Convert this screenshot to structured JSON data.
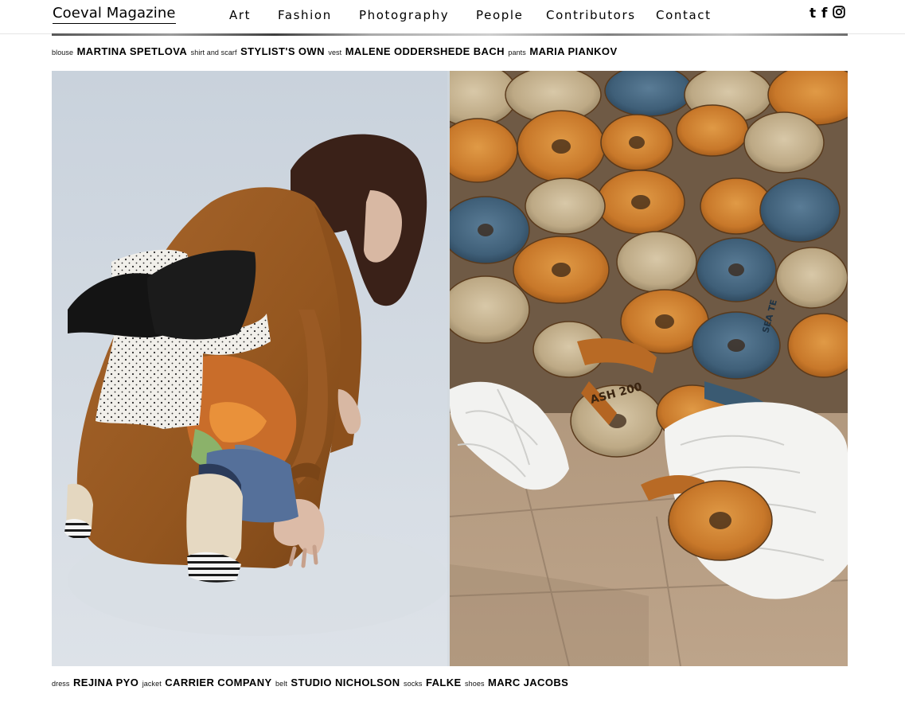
{
  "header": {
    "brand": "Coeval Magazine",
    "nav": [
      {
        "label": "Art"
      },
      {
        "label": "Fashion"
      },
      {
        "label": "Photography"
      },
      {
        "label": "People"
      },
      {
        "label": "Contributors"
      },
      {
        "label": "Contact"
      }
    ],
    "social": {
      "tumblr_glyph": "t",
      "facebook_glyph": "f",
      "icons": [
        "tumblr-icon",
        "facebook-icon",
        "instagram-icon"
      ]
    }
  },
  "credits_top": [
    {
      "item": "blouse",
      "name": "MARTINA SPETLOVA"
    },
    {
      "item": "shirt and scarf",
      "name": "STYLIST'S OWN"
    },
    {
      "item": "vest",
      "name": "MALENE ODDERSHEDE BACH"
    },
    {
      "item": "pants",
      "name": "MARIA PIANKOV"
    }
  ],
  "credits_bottom": [
    {
      "item": "dress",
      "name": "REJINA PYO"
    },
    {
      "item": "jacket",
      "name": "CARRIER COMPANY"
    },
    {
      "item": "belt",
      "name": "STUDIO NICHOLSON"
    },
    {
      "item": "socks",
      "name": "FALKE"
    },
    {
      "item": "shoes",
      "name": "MARC JACOBS"
    }
  ],
  "photos": {
    "left": {
      "subject": "model-kneeling-in-brown-coat"
    },
    "right": {
      "subject": "piles-of-rolled-straps"
    },
    "strap_print": "ASH 200",
    "strap_print_2": "SEA TE"
  },
  "colors": {
    "background": "#ffffff",
    "text": "#000000",
    "header_border": "#e5e5e5",
    "backdrop": "#cfd8e2",
    "coat": "#9a5a24",
    "strap_orange": "#c8782a",
    "strap_blue": "#3f5f78",
    "pavement": "#b3997e"
  }
}
